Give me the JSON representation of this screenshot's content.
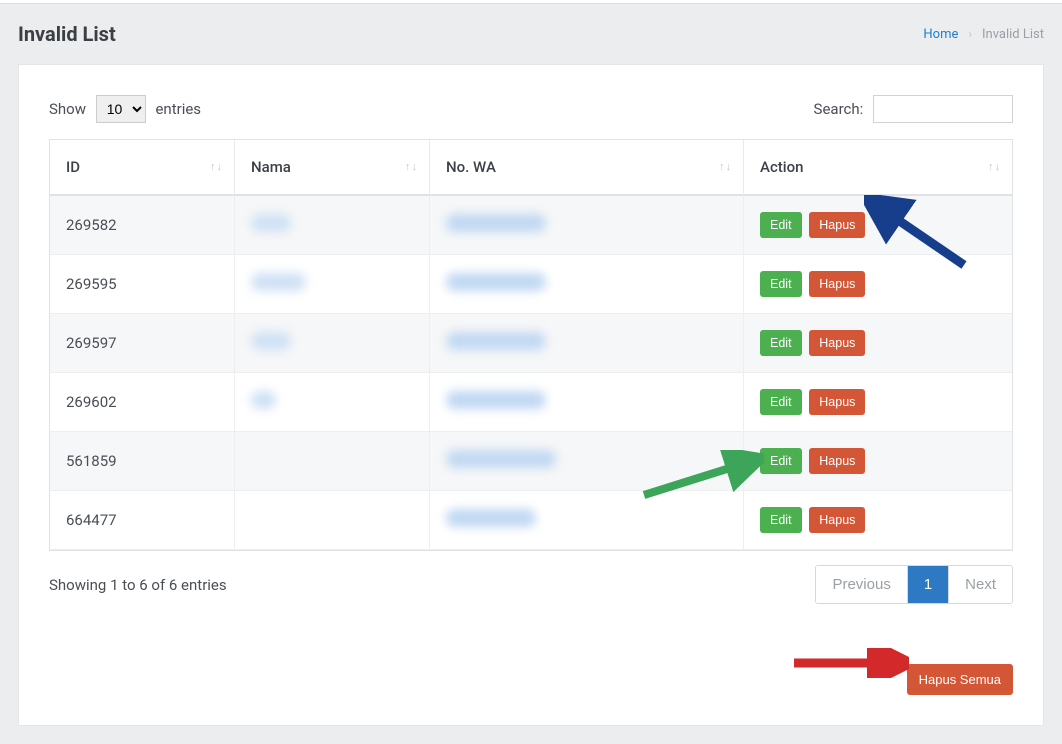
{
  "page": {
    "title": "Invalid List"
  },
  "breadcrumb": {
    "home": "Home",
    "current": "Invalid List"
  },
  "datatable": {
    "show_label_pre": "Show",
    "show_label_post": "entries",
    "length_value": "10",
    "search_label": "Search:",
    "search_value": "",
    "columns": {
      "id": "ID",
      "nama": "Nama",
      "nowa": "No. WA",
      "action": "Action"
    },
    "rows": [
      {
        "id": "269582"
      },
      {
        "id": "269595"
      },
      {
        "id": "269597"
      },
      {
        "id": "269602"
      },
      {
        "id": "561859"
      },
      {
        "id": "664477"
      }
    ],
    "buttons": {
      "edit": "Edit",
      "hapus": "Hapus"
    },
    "info": "Showing 1 to 6 of 6 entries",
    "pagination": {
      "previous": "Previous",
      "page1": "1",
      "next": "Next"
    }
  },
  "bottom": {
    "hapus_semua": "Hapus Semua"
  }
}
